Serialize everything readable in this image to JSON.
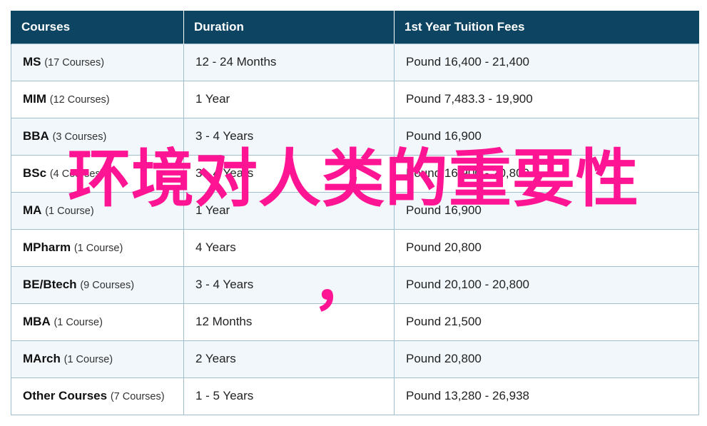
{
  "table": {
    "headers": [
      "Courses",
      "Duration",
      "1st Year Tuition Fees"
    ],
    "rows": [
      {
        "name": "MS",
        "count": "(17 Courses)",
        "duration": "12 - 24 Months",
        "fees": "Pound 16,400 - 21,400"
      },
      {
        "name": "MIM",
        "count": "(12 Courses)",
        "duration": "1 Year",
        "fees": "Pound 7,483.3 - 19,900"
      },
      {
        "name": "BBA",
        "count": "(3 Courses)",
        "duration": "3 - 4 Years",
        "fees": "Pound 16,900"
      },
      {
        "name": "BSc",
        "count": "(4 Courses)",
        "duration": "3 - 4 Years",
        "fees": "Pound 16,900 - 20,800"
      },
      {
        "name": "MA",
        "count": "(1 Course)",
        "duration": "1 Year",
        "fees": "Pound 16,900"
      },
      {
        "name": "MPharm",
        "count": "(1 Course)",
        "duration": "4 Years",
        "fees": "Pound 20,800"
      },
      {
        "name": "BE/Btech",
        "count": "(9 Courses)",
        "duration": "3 - 4 Years",
        "fees": "Pound 20,100 - 20,800"
      },
      {
        "name": "MBA",
        "count": "(1 Course)",
        "duration": "12 Months",
        "fees": "Pound 21,500"
      },
      {
        "name": "MArch",
        "count": "(1 Course)",
        "duration": "2 Years",
        "fees": "Pound 20,800"
      },
      {
        "name": "Other Courses",
        "count": "(7 Courses)",
        "duration": "1 - 5 Years",
        "fees": "Pound 13,280 - 26,938"
      }
    ]
  },
  "overlay": {
    "title": "环境对人类的重要性",
    "comma": "，",
    "color": "#ff1493"
  },
  "colors": {
    "header_bg": "#0d4462",
    "row_alt_bg": "#f1f7fb",
    "border": "#9fbfcf"
  }
}
